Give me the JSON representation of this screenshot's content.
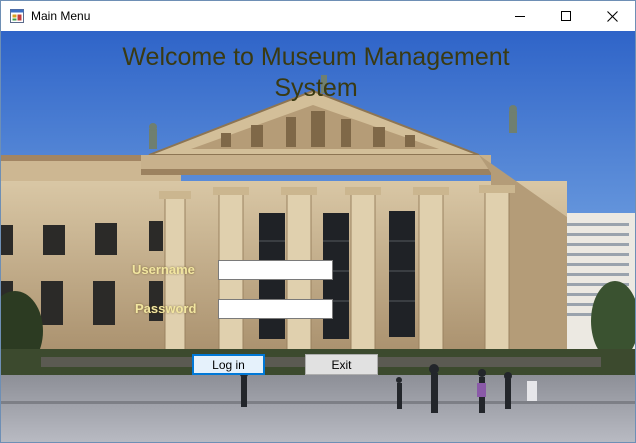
{
  "window": {
    "title": "Main Menu",
    "icon": "form-app-icon",
    "controls": [
      "minimize-icon",
      "maximize-icon",
      "close-icon"
    ]
  },
  "main": {
    "heading_line1": "Welcome to Museum Management",
    "heading_line2": "System",
    "background": "museum-building-photo",
    "username_label": "Username",
    "username_value": "",
    "password_label": "Password",
    "password_value": "",
    "login_button": "Log in",
    "exit_button": "Exit"
  },
  "colors": {
    "heading": "#3a3a12",
    "label": "#f2e6a0",
    "focus_border": "#0078d7"
  }
}
